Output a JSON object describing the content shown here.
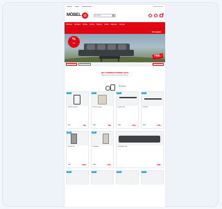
{
  "colors": {
    "brand": "#e30613",
    "tag": "#3aa3d8",
    "background": "#f3f6fb"
  },
  "header": {
    "logo_text": "MÖBEL",
    "search_placeholder": "Suchen ...",
    "icons": [
      "user-icon",
      "heart-icon",
      "cart-icon"
    ]
  },
  "nav": {
    "items": [
      "Wohnen",
      "Schlafen",
      "Küche",
      "Garten",
      "Marken",
      "Outlet",
      "Aktionen",
      "Service"
    ],
    "sub_label": "Prospekt"
  },
  "hero": {
    "sticker_main": "%",
    "sticker_sub": "Sale",
    "price": "799,-",
    "chips": [
      "Gartenmöbel",
      "Jetzt entdecken",
      "Loungemöbel"
    ]
  },
  "welcome": {
    "title": "WILLKOMMEN IM MÖBELHAUS",
    "line1": "Möbel online kaufen zu günstigen Preisen"
  },
  "deco": {
    "label": "Neuheiten"
  },
  "products": [
    {
      "tag": "SALE",
      "name": "Stuhl Esszimmer",
      "old": "99,-",
      "price": "49,-"
    },
    {
      "tag": "SALE",
      "name": "Sessel Lounge",
      "old": "149,-",
      "price": "89,-"
    },
    {
      "tag": "SALE",
      "name": "Esstisch Set",
      "old": "399,-",
      "price": "299,-"
    },
    {
      "tag": "SALE",
      "name": "Stuhl Set",
      "old": "199,-",
      "price": "129,-"
    },
    {
      "tag": "SALE",
      "name": "Schrank Set",
      "old": "499,-",
      "price": "349,-"
    },
    {
      "tag": "SALE",
      "name": "Kommode",
      "old": "249,-",
      "price": "179,-"
    },
    {
      "tag": "",
      "name": "Wohnlandschaft",
      "old": "",
      "price": "999,-"
    }
  ]
}
